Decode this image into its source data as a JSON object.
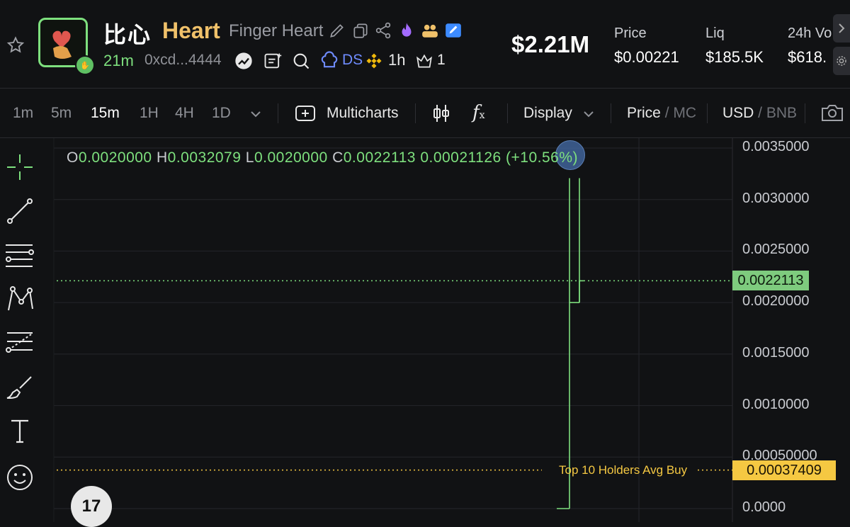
{
  "token": {
    "cn_name": "比心",
    "symbol": "Heart",
    "full_name": "Finger Heart",
    "age": "21m",
    "address": "0xcd...4444",
    "ds_label": "DS",
    "timeframe_badge": "1h",
    "holders_count": "1"
  },
  "header_icons": [
    "edit-icon",
    "copy-icon",
    "share-icon",
    "fire-icon",
    "users-icon",
    "pencil-badge-icon"
  ],
  "market_cap": "$2.21M",
  "stats": [
    {
      "label": "Price",
      "value": "$0.00221"
    },
    {
      "label": "Liq",
      "value": "$185.5K"
    },
    {
      "label": "24h Vo",
      "value": "$618."
    }
  ],
  "toolbar": {
    "timeframes": [
      "1m",
      "5m",
      "15m",
      "1H",
      "4H",
      "1D"
    ],
    "active_timeframe": "15m",
    "multicharts": "Multicharts",
    "fx": "f",
    "display": "Display",
    "price": "Price",
    "mc": "MC",
    "usd": "USD",
    "bnb": "BNB"
  },
  "ohlc": {
    "o_key": "O",
    "o": "0.0020000",
    "h_key": "H",
    "h": "0.0032079",
    "l_key": "L",
    "l": "0.0020000",
    "c_key": "C",
    "c": "0.0022113",
    "change": "0.00021126",
    "change_pct": "(+10.56%)"
  },
  "chart_data": {
    "type": "line",
    "title": "",
    "y_ticks": [
      "0.0035000",
      "0.0030000",
      "0.0025000",
      "0.0020000",
      "0.0015000",
      "0.0010000",
      "0.00050000",
      "0.0000"
    ],
    "ylim": [
      0,
      0.0035
    ],
    "current_price": "0.0022113",
    "avg_buy_label": "Top 10 Holders Avg Buy",
    "avg_buy_price": "0.00037409",
    "candles": [
      {
        "o": 0.002,
        "h": 0.0032079,
        "l": 0.0,
        "c": 0.0022113
      }
    ],
    "colors": {
      "up": "#7ee07e",
      "avg": "#f5c842",
      "grid": "#25262b"
    }
  },
  "tv_logo": "17"
}
